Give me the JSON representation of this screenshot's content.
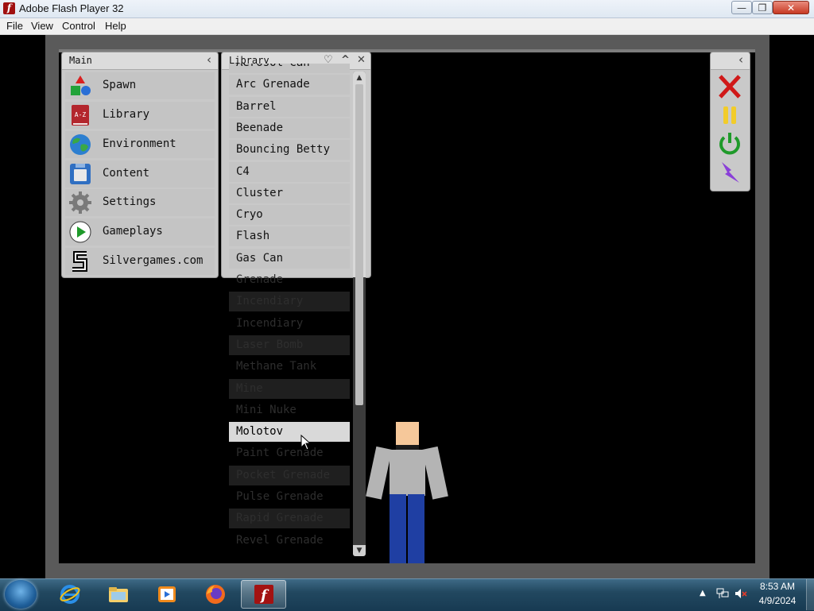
{
  "window": {
    "title": "Adobe Flash Player 32",
    "close_glyph": "✕",
    "max_glyph": "❐",
    "min_glyph": "—"
  },
  "menubar": {
    "items": [
      "File",
      "View",
      "Control",
      "Help"
    ]
  },
  "main_panel": {
    "title": "Main",
    "collapse_glyph": "‹",
    "items": [
      {
        "label": "Spawn",
        "icon": "shapes-icon"
      },
      {
        "label": "Library",
        "icon": "a-z-book-icon"
      },
      {
        "label": "Environment",
        "icon": "globe-icon"
      },
      {
        "label": "Content",
        "icon": "floppy-disk-icon"
      },
      {
        "label": "Settings",
        "icon": "gear-icon"
      },
      {
        "label": "Gameplays",
        "icon": "play-icon"
      },
      {
        "label": "Silvergames.com",
        "icon": "silvergames-s-icon"
      }
    ]
  },
  "library_panel": {
    "title": "Library",
    "heart_glyph": "♡",
    "up_glyph": "^",
    "close_glyph": "✕",
    "scroll_up_glyph": "▲",
    "scroll_down_glyph": "▼",
    "selected": "Molotov",
    "items": [
      "Aerosol Can",
      "Arc Grenade",
      "Barrel",
      "Beenade",
      "Bouncing Betty",
      "C4",
      "Cluster",
      "Cryo",
      "Flash",
      "Gas Can",
      "Grenade",
      "Incendiary",
      "Incendiary",
      "Laser Bomb",
      "Methane Tank",
      "Mine",
      "Mini Nuke",
      "Molotov",
      "Paint Grenade",
      "Pocket Grenade",
      "Pulse Grenade",
      "Rapid Grenade",
      "Revel Grenade"
    ]
  },
  "tool_panel": {
    "collapse_glyph": "‹",
    "tools": [
      "close-x-icon",
      "pause-icon",
      "power-icon",
      "lightning-icon"
    ]
  },
  "taskbar": {
    "apps": [
      "internet-explorer-icon",
      "file-explorer-icon",
      "media-player-icon",
      "firefox-icon",
      "flash-player-icon"
    ],
    "active_app": "flash-player-icon",
    "tray_arrow": "▲",
    "time": "8:53 AM",
    "date": "4/9/2024"
  },
  "colors": {
    "panel_bg": "#c9c9c9",
    "stage_bg": "#000000",
    "ragdoll_skin": "#f6c89a",
    "ragdoll_shirt": "#b4b4b4",
    "ragdoll_pants": "#1f3fa3"
  }
}
